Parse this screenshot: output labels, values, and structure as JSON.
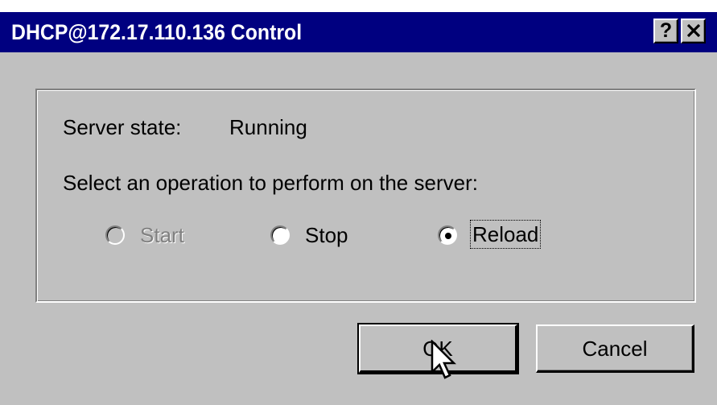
{
  "window": {
    "title": "DHCP@172.17.110.136 Control",
    "help_label": "?"
  },
  "status": {
    "server_state_label": "Server state:",
    "server_state_value": "Running"
  },
  "operation": {
    "prompt": "Select an operation to perform on the server:",
    "options": [
      {
        "label": "Start",
        "enabled": false,
        "selected": false
      },
      {
        "label": "Stop",
        "enabled": true,
        "selected": false
      },
      {
        "label": "Reload",
        "enabled": true,
        "selected": true
      }
    ]
  },
  "buttons": {
    "ok_label": "OK",
    "cancel_label": "Cancel"
  },
  "colors": {
    "title_bar": "#000080",
    "dialog_face": "#c0c0c0",
    "disabled_text": "#808080"
  },
  "icons": {
    "close": "close-icon",
    "cursor": "mouse-pointer-icon"
  }
}
